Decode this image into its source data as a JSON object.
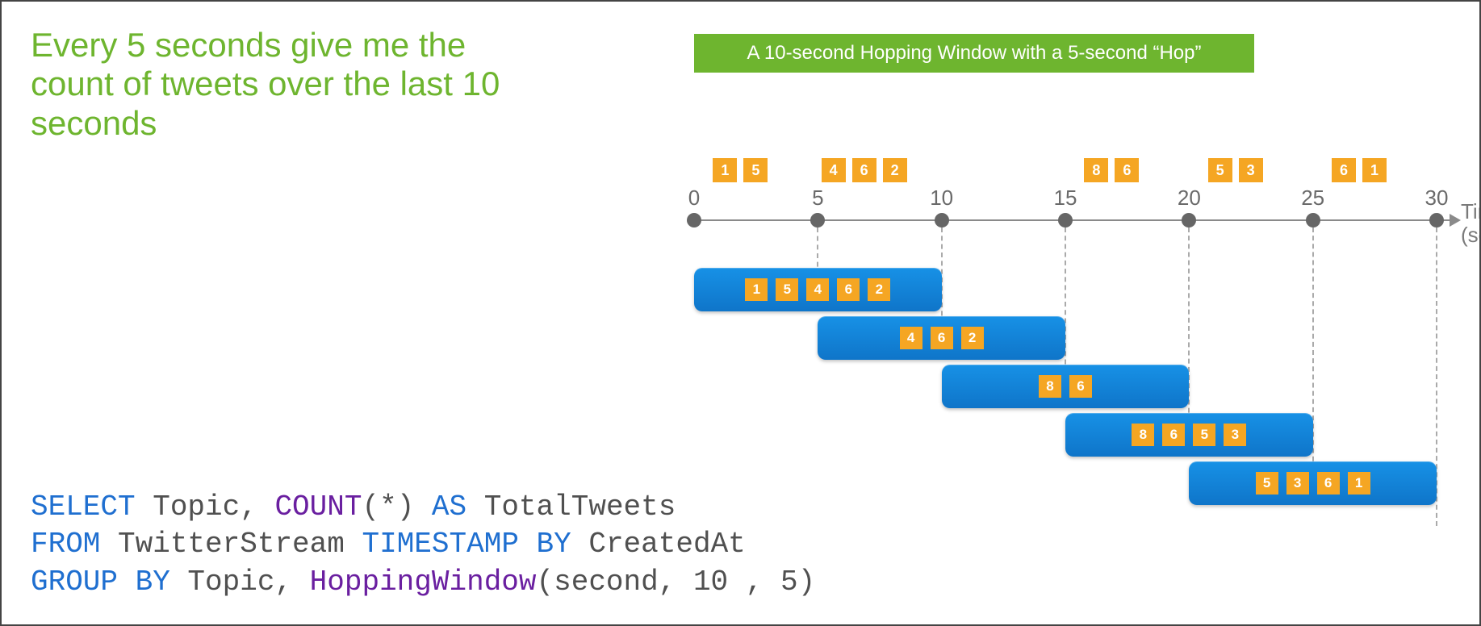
{
  "statement": "Every 5 seconds give me the count of tweets over the last 10 seconds",
  "banner": "A 10-second Hopping Window with a 5-second “Hop”",
  "axis": {
    "label_line1": "Time",
    "label_line2": "(secs)",
    "ticks": [
      0,
      5,
      10,
      15,
      20,
      25,
      30
    ]
  },
  "timeline_events": [
    {
      "at": 2,
      "values": [
        1,
        5
      ]
    },
    {
      "at": 7,
      "values": [
        4,
        6,
        2
      ]
    },
    {
      "at": 17,
      "values": [
        8,
        6
      ]
    },
    {
      "at": 22,
      "values": [
        5,
        3
      ]
    },
    {
      "at": 27,
      "values": [
        6,
        1
      ]
    }
  ],
  "windows": [
    {
      "start": 0,
      "end": 10,
      "values": [
        1,
        5,
        4,
        6,
        2
      ]
    },
    {
      "start": 5,
      "end": 15,
      "values": [
        4,
        6,
        2
      ]
    },
    {
      "start": 10,
      "end": 20,
      "values": [
        8,
        6
      ]
    },
    {
      "start": 15,
      "end": 25,
      "values": [
        8,
        6,
        5,
        3
      ]
    },
    {
      "start": 20,
      "end": 30,
      "values": [
        5,
        3,
        6,
        1
      ]
    }
  ],
  "sql": {
    "select_kw": "SELECT",
    "select_rest": " Topic, ",
    "count_fn": "COUNT",
    "count_args": "(*) ",
    "as_kw": "AS",
    "as_rest": " TotalTweets",
    "from_kw": "FROM",
    "from_rest": " TwitterStream ",
    "ts_kw": "TIMESTAMP BY",
    "ts_rest": " CreatedAt",
    "group_kw": "GROUP BY",
    "group_rest": " Topic, ",
    "hop_fn": "HoppingWindow",
    "hop_args": "(second, 10 , 5)"
  },
  "chart_data": {
    "type": "diagram",
    "title": "A 10-second Hopping Window with a 5-second Hop",
    "xlabel": "Time (secs)",
    "x_ticks": [
      0,
      5,
      10,
      15,
      20,
      25,
      30
    ],
    "events": [
      {
        "t_approx": 2,
        "values": [
          1,
          5
        ]
      },
      {
        "t_approx": 7,
        "values": [
          4,
          6,
          2
        ]
      },
      {
        "t_approx": 17,
        "values": [
          8,
          6
        ]
      },
      {
        "t_approx": 22,
        "values": [
          5,
          3
        ]
      },
      {
        "t_approx": 27,
        "values": [
          6,
          1
        ]
      }
    ],
    "windows": [
      {
        "start": 0,
        "end": 10,
        "contents": [
          1,
          5,
          4,
          6,
          2
        ]
      },
      {
        "start": 5,
        "end": 15,
        "contents": [
          4,
          6,
          2
        ]
      },
      {
        "start": 10,
        "end": 20,
        "contents": [
          8,
          6
        ]
      },
      {
        "start": 15,
        "end": 25,
        "contents": [
          8,
          6,
          5,
          3
        ]
      },
      {
        "start": 20,
        "end": 30,
        "contents": [
          5,
          3,
          6,
          1
        ]
      }
    ],
    "window_size_sec": 10,
    "hop_sec": 5
  }
}
